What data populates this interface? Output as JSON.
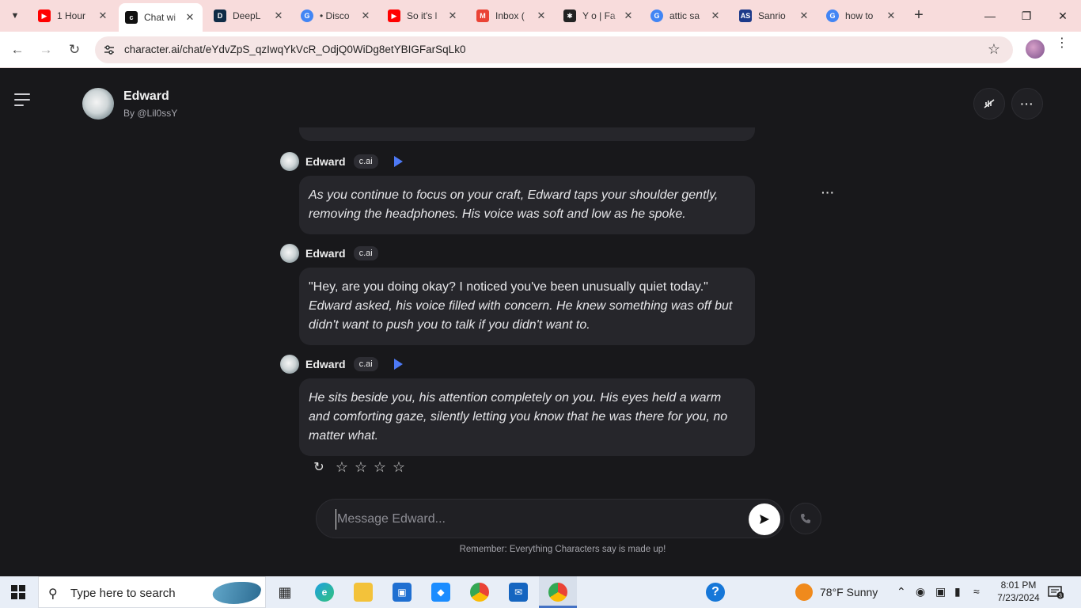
{
  "browser": {
    "tabs": [
      {
        "title": "1 Hour",
        "favicon": "youtube-icon",
        "color": "#ff0000"
      },
      {
        "title": "Chat wi",
        "favicon": "characterai-icon",
        "color": "#111111",
        "active": true
      },
      {
        "title": "DeepL",
        "favicon": "deepl-icon",
        "color": "#0f2b46"
      },
      {
        "title": "• Disco",
        "favicon": "google-lens-icon",
        "color": "#4285f4"
      },
      {
        "title": "So it's l",
        "favicon": "youtube-icon",
        "color": "#ff0000"
      },
      {
        "title": "Inbox (",
        "favicon": "gmail-icon",
        "color": "#ea4335"
      },
      {
        "title": "Y o | Fa",
        "favicon": "ao3-icon",
        "color": "#222222"
      },
      {
        "title": "attic sa",
        "favicon": "google-icon",
        "color": "#4285f4"
      },
      {
        "title": "Sanrio",
        "favicon": "as-icon",
        "color": "#1d3a8a"
      },
      {
        "title": "how to",
        "favicon": "google-icon",
        "color": "#4285f4"
      }
    ],
    "url": "character.ai/chat/eYdvZpS_qzIwqYkVcR_OdjQ0WiDg8etYBIGFarSqLk0"
  },
  "header": {
    "character_name": "Edward",
    "author": "By @Lil0ssY"
  },
  "messages": [
    {
      "name": "Edward",
      "badge": "c.ai",
      "has_play": true,
      "text": "As you continue to focus on your craft, Edward taps your shoulder gently, removing the headphones. His voice was soft and low as he spoke.",
      "italic": true
    },
    {
      "name": "Edward",
      "badge": "c.ai",
      "has_play": false,
      "quote": "\"Hey, are you doing okay? I noticed you've been unusually quiet today.\"",
      "text": "Edward asked, his voice filled with concern. He knew something was off but didn't want to push you to talk if you didn't want to."
    },
    {
      "name": "Edward",
      "badge": "c.ai",
      "has_play": true,
      "text": "He sits beside you, his attention completely on you. His eyes held a warm and comforting gaze, silently letting you know that he was there for you, no matter what.",
      "italic": true
    }
  ],
  "rating": {
    "stars": 4,
    "filled": 0
  },
  "composer": {
    "placeholder": "Message Edward..."
  },
  "disclaimer": "Remember: Everything Characters say is made up!",
  "taskbar": {
    "search_placeholder": "Type here to search",
    "weather": "78°F  Sunny",
    "time": "8:01 PM",
    "date": "7/23/2024",
    "notifications": "3"
  }
}
